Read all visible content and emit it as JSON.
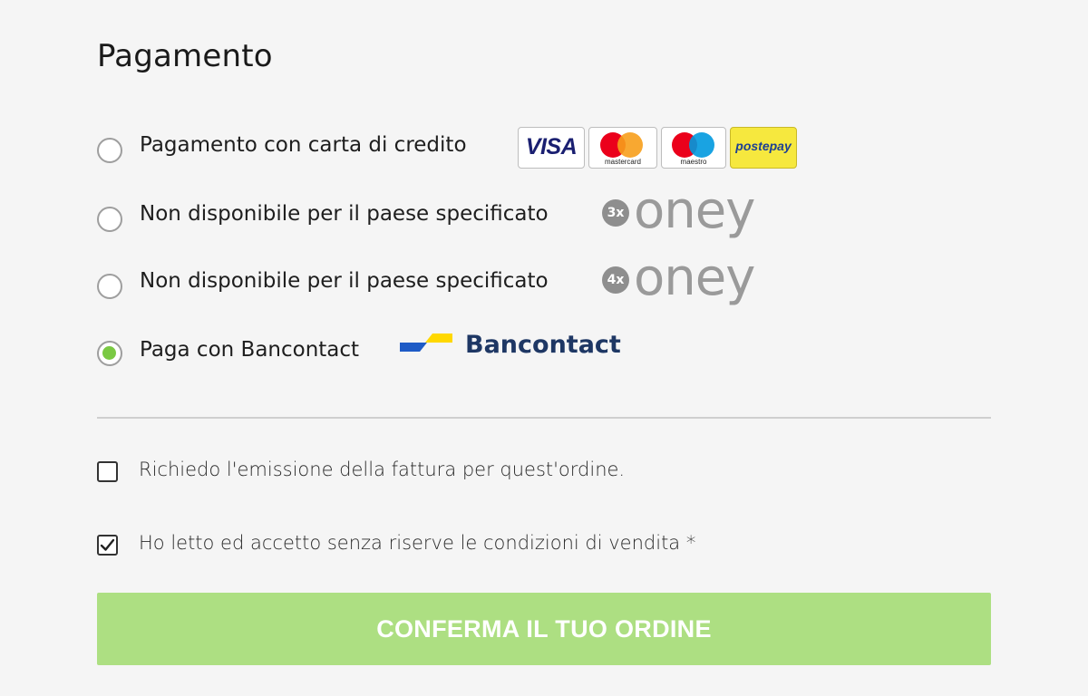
{
  "section_title": "Pagamento",
  "payment_options": [
    {
      "label": "Pagamento con carta di credito",
      "selected": false
    },
    {
      "label": "Non disponibile per il paese specificato",
      "selected": false,
      "badge": "3x",
      "brand": "oney"
    },
    {
      "label": "Non disponibile per il paese specificato",
      "selected": false,
      "badge": "4x",
      "brand": "oney"
    },
    {
      "label": "Paga con Bancontact",
      "selected": true,
      "brand": "Bancontact"
    }
  ],
  "card_logos": {
    "visa": "VISA",
    "mastercard": "mastercard",
    "maestro": "maestro",
    "postepay": "postepay"
  },
  "invoice_checkbox": {
    "label": "Richiedo l'emissione della fattura per quest'ordine.",
    "checked": false
  },
  "terms_checkbox": {
    "label": "Ho letto ed accetto senza riserve le condizioni di vendita *",
    "checked": true
  },
  "confirm_button": {
    "label": "CONFERMA IL TUO ORDINE"
  },
  "colors": {
    "radio_selected": "#7ac943",
    "button_bg": "#addf82",
    "oney_gray": "#9a9a9a",
    "bancontact_blue": "#1e3764"
  }
}
